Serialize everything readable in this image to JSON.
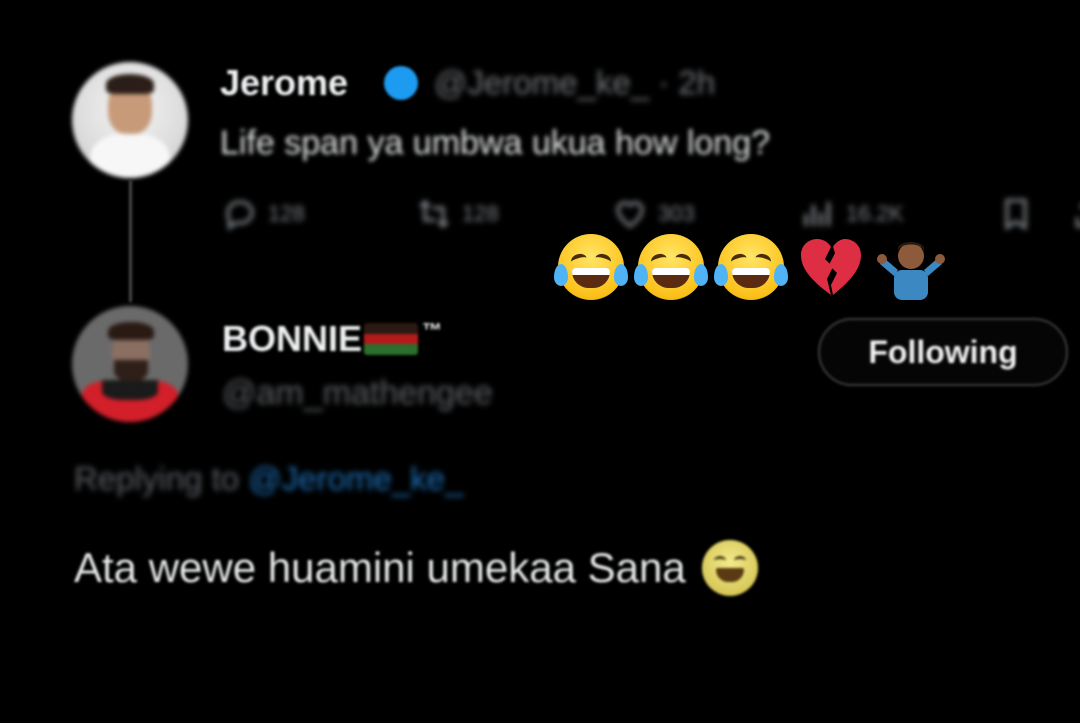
{
  "tweet": {
    "author_name": "Jerome",
    "author_handle_meta": "@Jerome_ke_ · 2h",
    "text": "Life span ya umbwa ukua how long?",
    "reply_count": "128",
    "retweet_count": "128",
    "like_count": "303",
    "views_count": "16.2K"
  },
  "reaction_emojis": [
    "face-with-tears-of-joy",
    "face-with-tears-of-joy",
    "face-with-tears-of-joy",
    "broken-heart",
    "person-shrugging"
  ],
  "reply": {
    "author_name": "BONNIE",
    "trademark": "™",
    "author_handle": "@am_mathengee",
    "follow_button_label": "Following",
    "replying_prefix": "Replying to ",
    "replying_mention": "@Jerome_ke_",
    "text": "Ata wewe huamini umekaa Sana"
  },
  "colors": {
    "background": "#000000",
    "verified_badge": "#1d9bf0",
    "mention": "#1d6fb8",
    "muted_text": "#71767b"
  }
}
